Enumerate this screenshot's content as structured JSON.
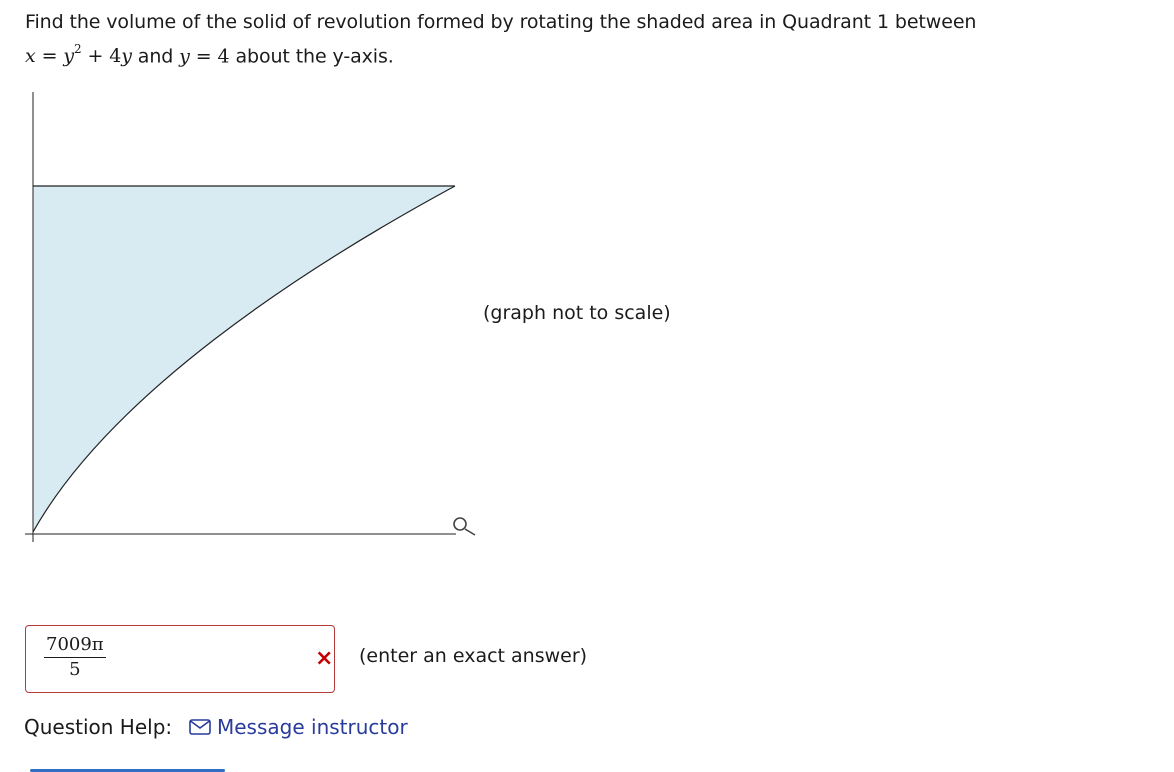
{
  "question": {
    "text_before": "Find the volume of the solid of revolution formed by rotating the shaded area in Quadrant 1 between",
    "eq1_lhs": "x",
    "eq1_eq": " = ",
    "eq1_y": "y",
    "eq1_exp": "2",
    "eq1_rest": " + 4",
    "eq1_y2": "y",
    "and": " and ",
    "eq2_lhs": "y",
    "eq2_rest": " = 4",
    "text_after": " about the y-axis."
  },
  "graph": {
    "note": "(graph not to scale)",
    "fill_color": "#d8ebf2",
    "magnify_icon": "magnifying-glass-icon"
  },
  "answer": {
    "numerator": "7009π",
    "denominator": "5",
    "status_icon": "incorrect-x-icon",
    "status_mark": "×",
    "hint": "(enter an exact answer)",
    "border_color": "#b43a3a"
  },
  "help": {
    "label": "Question Help:",
    "message_icon": "envelope-icon",
    "message_link": "Message instructor",
    "link_color": "#2a3c9b"
  }
}
